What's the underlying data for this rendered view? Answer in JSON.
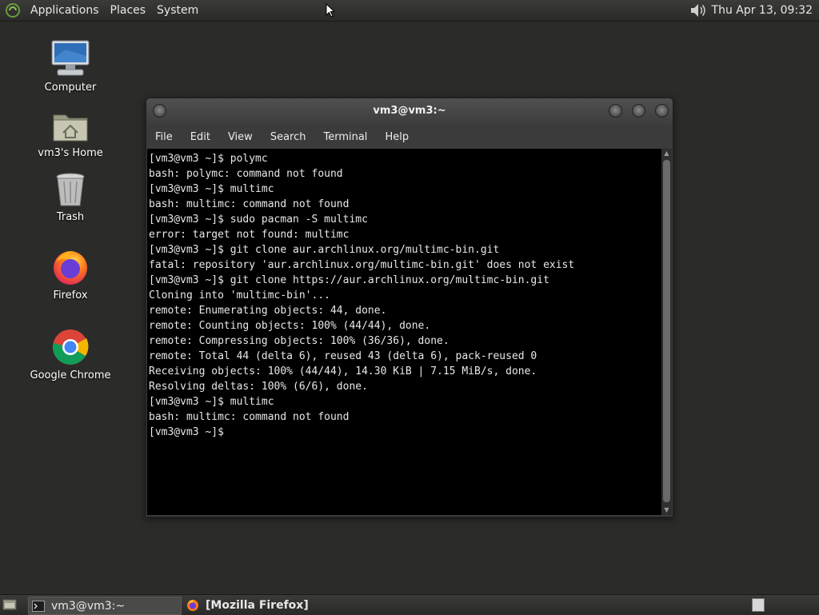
{
  "top_panel": {
    "menus": [
      "Applications",
      "Places",
      "System"
    ],
    "clock": "Thu Apr 13, 09:32"
  },
  "desktop": {
    "icons": [
      {
        "label": "Computer",
        "icon": "computer-icon"
      },
      {
        "label": "vm3's Home",
        "icon": "home-folder-icon"
      },
      {
        "label": "Trash",
        "icon": "trash-icon"
      },
      {
        "label": "Firefox",
        "icon": "firefox-icon"
      },
      {
        "label": "Google Chrome",
        "icon": "chrome-icon"
      }
    ]
  },
  "terminal": {
    "title": "vm3@vm3:~",
    "menu": [
      "File",
      "Edit",
      "View",
      "Search",
      "Terminal",
      "Help"
    ],
    "lines": [
      "[vm3@vm3 ~]$ polymc",
      "bash: polymc: command not found",
      "[vm3@vm3 ~]$ multimc",
      "bash: multimc: command not found",
      "[vm3@vm3 ~]$ sudo pacman -S multimc",
      "error: target not found: multimc",
      "[vm3@vm3 ~]$ git clone aur.archlinux.org/multimc-bin.git",
      "fatal: repository 'aur.archlinux.org/multimc-bin.git' does not exist",
      "[vm3@vm3 ~]$ git clone https://aur.archlinux.org/multimc-bin.git",
      "Cloning into 'multimc-bin'...",
      "remote: Enumerating objects: 44, done.",
      "remote: Counting objects: 100% (44/44), done.",
      "remote: Compressing objects: 100% (36/36), done.",
      "remote: Total 44 (delta 6), reused 43 (delta 6), pack-reused 0",
      "Receiving objects: 100% (44/44), 14.30 KiB | 7.15 MiB/s, done.",
      "Resolving deltas: 100% (6/6), done.",
      "[vm3@vm3 ~]$ multimc",
      "bash: multimc: command not found",
      "[vm3@vm3 ~]$ "
    ]
  },
  "taskbar": {
    "tasks": [
      {
        "label": "vm3@vm3:~",
        "icon": "terminal-icon"
      },
      {
        "label": "[Mozilla Firefox]",
        "icon": "firefox-icon"
      }
    ]
  },
  "colors": {
    "panel_bg": "#2e2f2c",
    "desktop_bg": "#2b2c29",
    "terminal_bg": "#000000",
    "terminal_fg": "#e8e8e8",
    "window_chrome": "#3b3b3b"
  }
}
